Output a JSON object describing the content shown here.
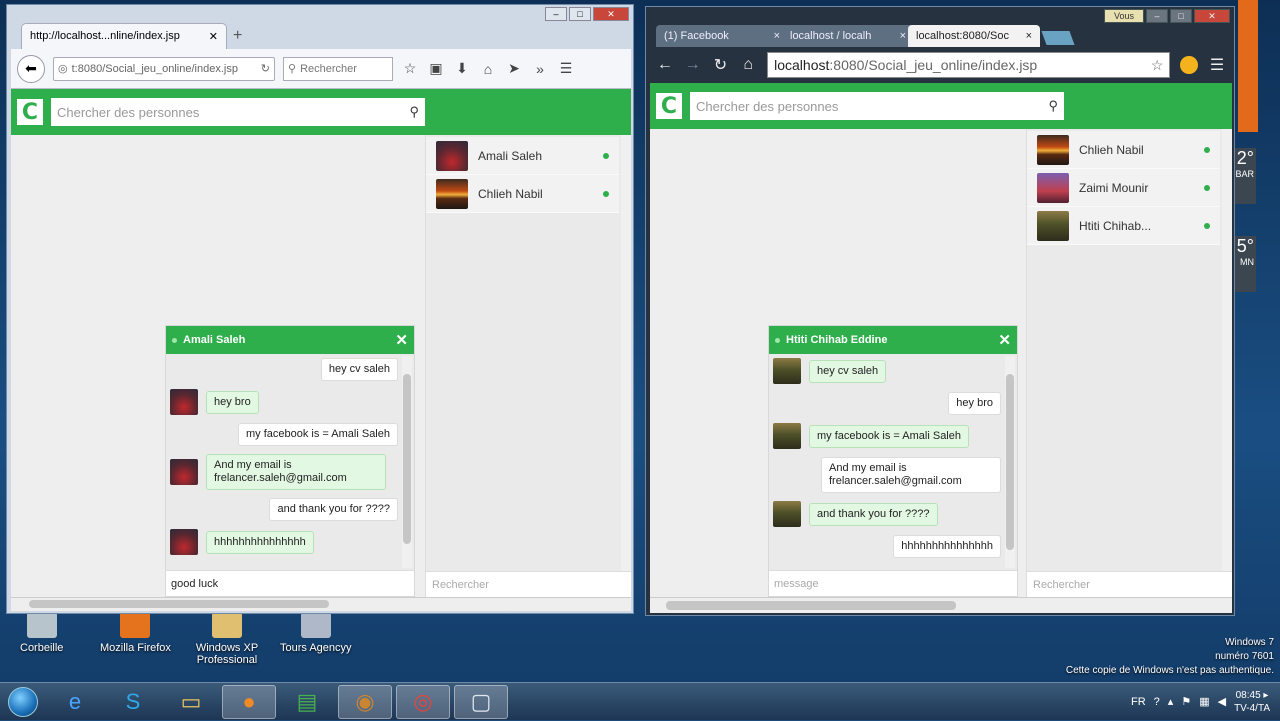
{
  "desktop": {
    "icons": [
      {
        "label": "Corbeille"
      },
      {
        "label": "Mozilla Firefox"
      },
      {
        "label": "Windows XP Professional"
      },
      {
        "label": "Tours Agencyy"
      }
    ],
    "gadget_temps": [
      "2°",
      "5°"
    ],
    "gadget_labels": [
      "BAR",
      "MN"
    ],
    "watermark": [
      "Windows 7",
      "numéro 7601",
      "Cette copie de Windows n'est pas authentique."
    ]
  },
  "taskbar": {
    "lang": "FR",
    "time": "08:45 ▸",
    "date": "TV-4/TA",
    "buttons": [
      "ie-icon",
      "skype-icon",
      "explorer-icon",
      "firefox-icon",
      "excel-icon",
      "app-icon",
      "chrome-icon",
      "window-icon"
    ]
  },
  "left_browser": {
    "tab_title": "http://localhost...nline/index.jsp",
    "url": "t:8080/Social_jeu_online/index.jsp",
    "search_placeholder": "Rechercher",
    "app": {
      "logo": "C",
      "search_placeholder": "Chercher des personnes",
      "contacts": [
        {
          "name": "Amali Saleh",
          "avatar": "red"
        },
        {
          "name": "Chlieh Nabil",
          "avatar": "sun"
        }
      ],
      "sidebar_search": "Rechercher",
      "chat": {
        "title": "Amali Saleh",
        "messages": [
          {
            "from": "me",
            "text": "hey cv saleh"
          },
          {
            "from": "them",
            "text": "hey bro"
          },
          {
            "from": "me",
            "text": "my facebook is = Amali Saleh"
          },
          {
            "from": "them",
            "text": "And my email is frelancer.saleh@gmail.com"
          },
          {
            "from": "me",
            "text": "and thank you for ????"
          },
          {
            "from": "them",
            "text": "hhhhhhhhhhhhhhh"
          }
        ],
        "input_value": "good luck"
      }
    }
  },
  "right_browser": {
    "tabs": [
      "(1) Facebook",
      "localhost / localh",
      "localhost:8080/Soc"
    ],
    "url_host": "localhost",
    "url_rest": ":8080/Social_jeu_online/index.jsp",
    "user_label": "Vous",
    "app": {
      "logo": "C",
      "search_placeholder": "Chercher des personnes",
      "contacts": [
        {
          "name": "Chlieh Nabil",
          "avatar": "sun"
        },
        {
          "name": "Zaimi Mounir",
          "avatar": "man"
        },
        {
          "name": "Htiti Chihab...",
          "avatar": "tree"
        }
      ],
      "sidebar_search": "Rechercher",
      "chat": {
        "title": "Htiti Chihab Eddine",
        "messages": [
          {
            "from": "them",
            "text": "hey cv saleh"
          },
          {
            "from": "me",
            "text": "hey bro"
          },
          {
            "from": "them",
            "text": "my facebook is = Amali Saleh"
          },
          {
            "from": "me",
            "text": "And my email is frelancer.saleh@gmail.com"
          },
          {
            "from": "them",
            "text": "and thank you for ????"
          },
          {
            "from": "me",
            "text": "hhhhhhhhhhhhhhh"
          }
        ],
        "input_placeholder": "message"
      }
    }
  }
}
